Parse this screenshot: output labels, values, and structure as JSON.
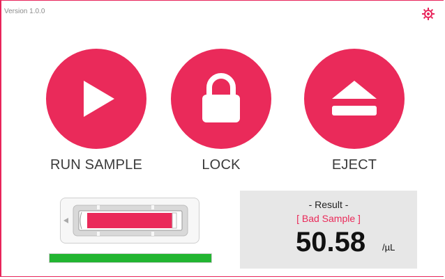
{
  "app": {
    "version": "Version 1.0.0"
  },
  "icons": {
    "settings": "settings-gear-icon"
  },
  "colors": {
    "accent": "#ea2a5a",
    "progress": "#22b531",
    "result_status": "#ea2a5a"
  },
  "actions": [
    {
      "label": "RUN SAMPLE",
      "icon": "play-icon"
    },
    {
      "label": "LOCK",
      "icon": "lock-icon"
    },
    {
      "label": "EJECT",
      "icon": "eject-icon"
    }
  ],
  "progress": {
    "value": 1.0
  },
  "result": {
    "title": "- Result -",
    "status": "[ Bad Sample ]",
    "value": "50.58",
    "unit": "/µL"
  }
}
